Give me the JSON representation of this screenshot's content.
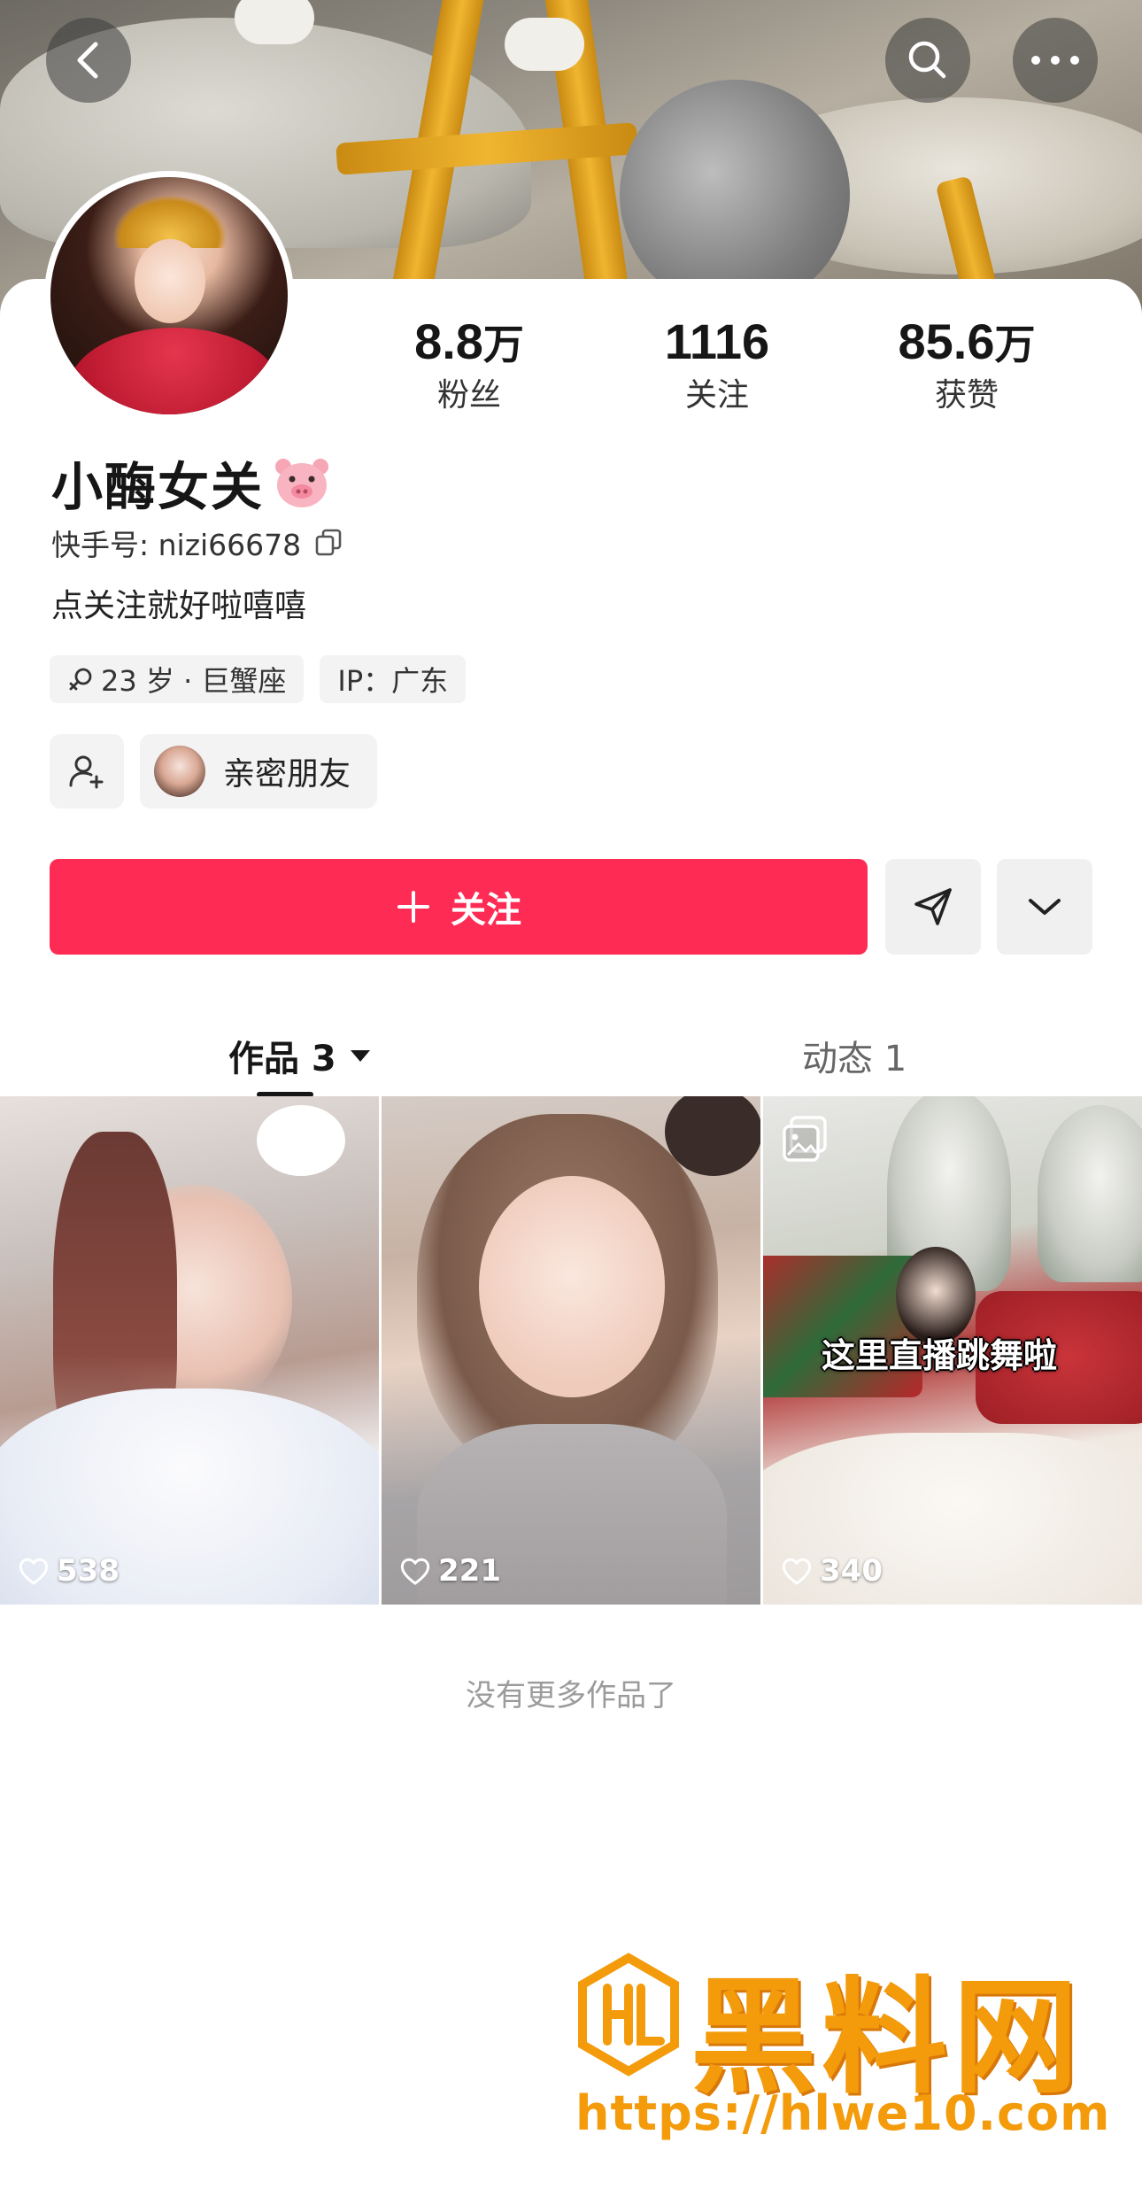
{
  "header": {
    "back_icon": "chevron-left-icon",
    "search_icon": "search-icon",
    "more_icon": "more-dots-icon"
  },
  "profile": {
    "name": "小酶女关",
    "name_emoji_icon": "pig-face-icon",
    "account_id": "快手号: nizi66678",
    "bio": "点关注就好啦嘻嘻",
    "stats": [
      {
        "value": "8.8",
        "unit": "万",
        "label": "粉丝"
      },
      {
        "value": "1116",
        "unit": "",
        "label": "关注"
      },
      {
        "value": "85.6",
        "unit": "万",
        "label": "获赞"
      }
    ],
    "tags": [
      {
        "icon": "gender-female-icon",
        "text": "23 岁 · 巨蟹座"
      },
      {
        "icon": "",
        "text": "IP：广东"
      }
    ],
    "close_friends_label": "亲密朋友"
  },
  "actions": {
    "follow_label": "关注",
    "follow_icon": "plus-icon",
    "send_icon": "paper-plane-icon",
    "dropdown_icon": "chevron-down-icon"
  },
  "tabs": [
    {
      "label": "作品 3",
      "active": true
    },
    {
      "label": "动态 1",
      "active": false
    }
  ],
  "works": [
    {
      "likes": "538",
      "overlay_text": ""
    },
    {
      "likes": "221",
      "overlay_text": ""
    },
    {
      "likes": "340",
      "overlay_text": "这里直播跳舞啦"
    }
  ],
  "footer_note": "没有更多作品了",
  "watermark": {
    "brand": "黑料网",
    "url": "https://hlwe10.com"
  },
  "colors": {
    "accent": "#fe2c55",
    "watermark": "#f39b0b"
  }
}
